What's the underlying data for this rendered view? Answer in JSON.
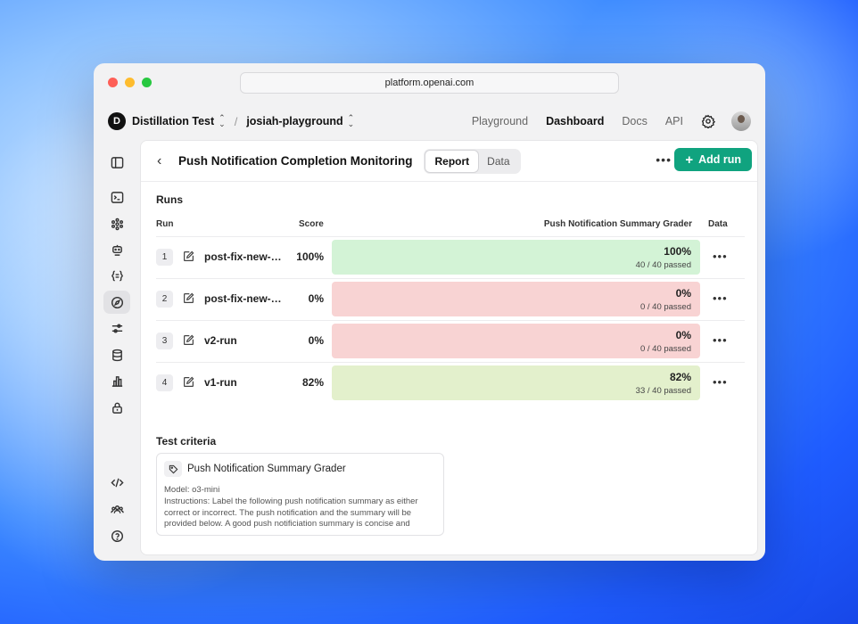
{
  "browser": {
    "url": "platform.openai.com"
  },
  "topnav": {
    "org_initial": "D",
    "org_name": "Distillation Test",
    "project_name": "josiah-playground",
    "links": [
      "Playground",
      "Dashboard",
      "Docs",
      "API"
    ],
    "active_link": "Dashboard"
  },
  "sidebar": {
    "icons": [
      "sidebar-toggle-icon",
      "terminal-icon",
      "assistants-icon",
      "bot-icon",
      "json-icon",
      "compass-icon",
      "sliders-icon",
      "database-icon",
      "chart-icon",
      "lock-icon",
      "code-icon",
      "users-icon",
      "help-icon"
    ],
    "active": "compass-icon"
  },
  "header": {
    "title": "Push Notification Completion Monitoring",
    "tabs": [
      "Report",
      "Data"
    ],
    "active_tab": "Report",
    "add_run_label": "Add run"
  },
  "runs": {
    "section_label": "Runs",
    "columns": {
      "run": "Run",
      "score": "Score",
      "grader": "Push Notification Summary Grader",
      "data": "Data"
    },
    "rows": [
      {
        "num": "1",
        "name": "post-fix-new-m...",
        "score": "100%",
        "grader_pct": "100%",
        "passed": "40 / 40 passed",
        "color": "#d3f3d6"
      },
      {
        "num": "2",
        "name": "post-fix-new-m...",
        "score": "0%",
        "grader_pct": "0%",
        "passed": "0 / 40 passed",
        "color": "#f8d3d3"
      },
      {
        "num": "3",
        "name": "v2-run",
        "score": "0%",
        "grader_pct": "0%",
        "passed": "0 / 40 passed",
        "color": "#f8d3d3"
      },
      {
        "num": "4",
        "name": "v1-run",
        "score": "82%",
        "grader_pct": "82%",
        "passed": "33 / 40 passed",
        "color": "#e3f0cc"
      }
    ]
  },
  "test_criteria": {
    "section_label": "Test criteria",
    "grader_name": "Push Notification Summary Grader",
    "model": "Model: o3-mini",
    "instructions": "Instructions: Label the following push notification summary as either correct or incorrect. The push notification and the summary will be provided below. A good push notificiation summary is concise and"
  }
}
